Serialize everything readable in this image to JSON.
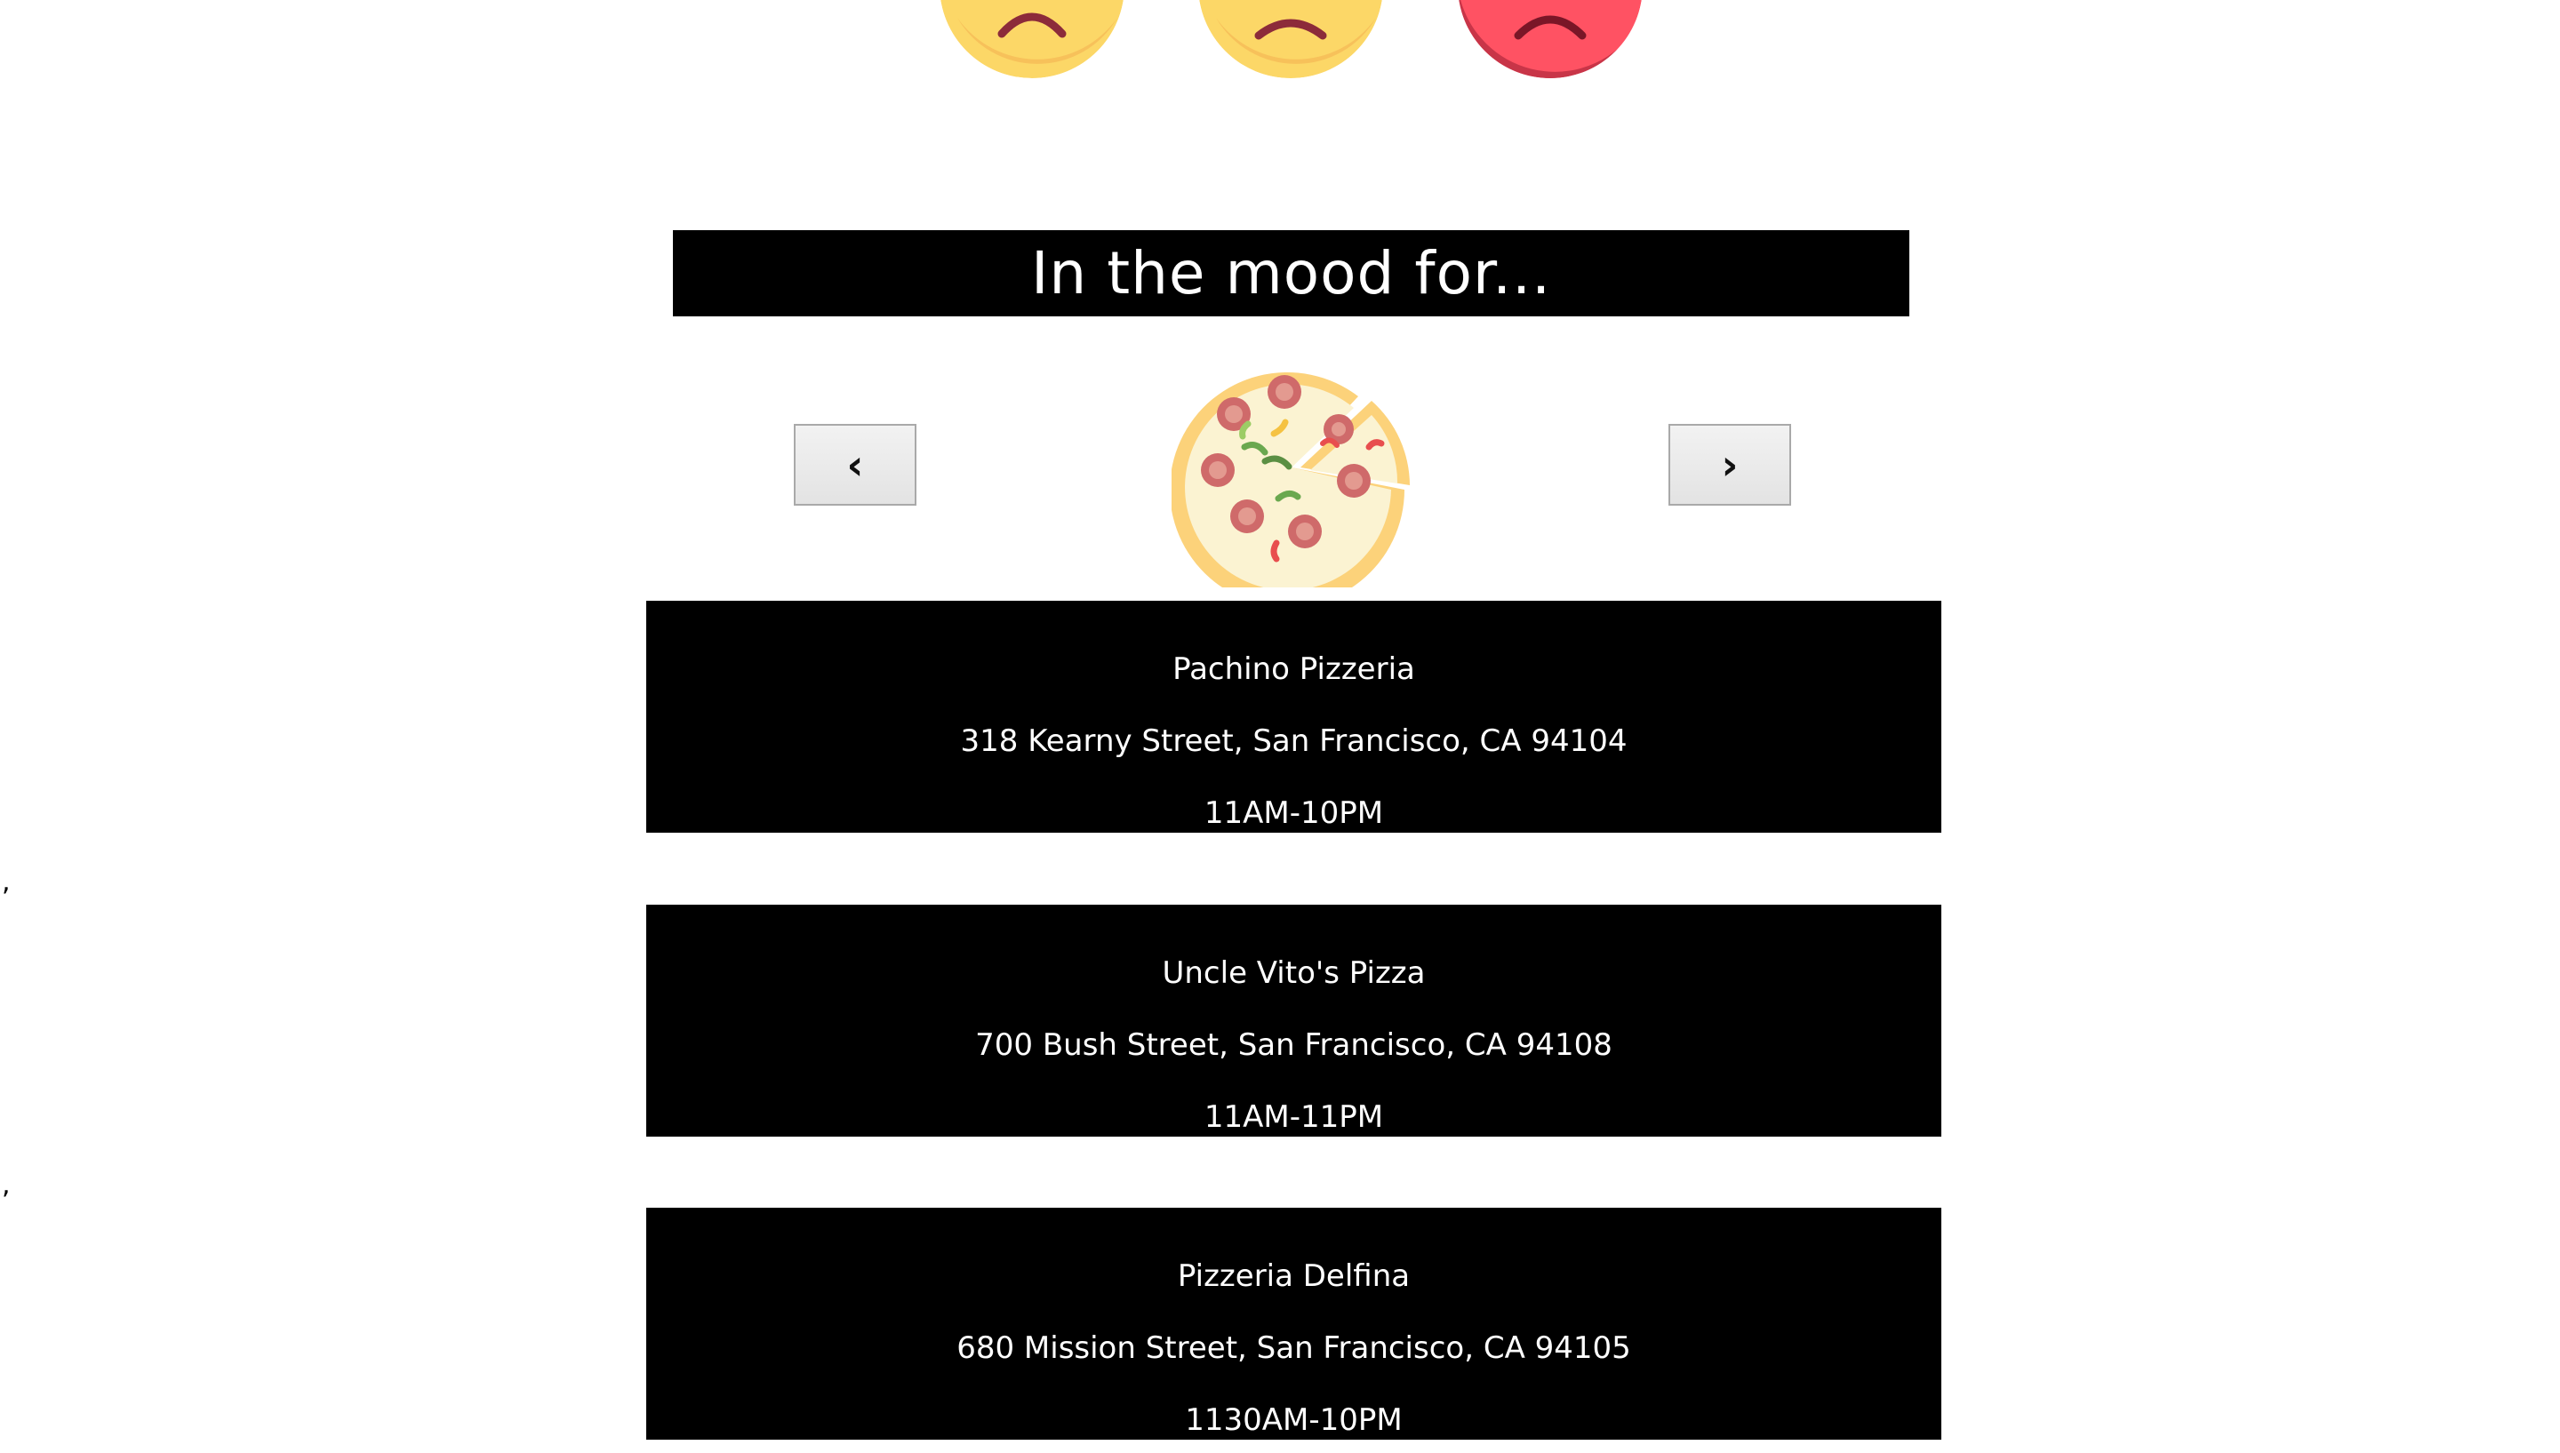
{
  "moods": {
    "faces": [
      {
        "icon": "sad-face-icon",
        "color": "#fcd767"
      },
      {
        "icon": "sad-face-icon",
        "color": "#fcd767"
      },
      {
        "icon": "angry-face-icon",
        "color": "#ff5263"
      }
    ]
  },
  "header": {
    "title": "In the mood for..."
  },
  "carousel": {
    "prev_label": "‹",
    "next_label": "›",
    "food_icon": "pizza-icon"
  },
  "restaurants": [
    {
      "name": "Pachino Pizzeria",
      "address": "318 Kearny Street, San Francisco, CA 94104",
      "hours": "11AM-10PM"
    },
    {
      "name": "Uncle Vito's Pizza",
      "address": "700 Bush Street, San Francisco, CA 94108",
      "hours": "11AM-11PM"
    },
    {
      "name": "Pizzeria Delfina",
      "address": "680 Mission Street, San Francisco, CA 94105",
      "hours": "1130AM-10PM"
    }
  ],
  "separator": ","
}
